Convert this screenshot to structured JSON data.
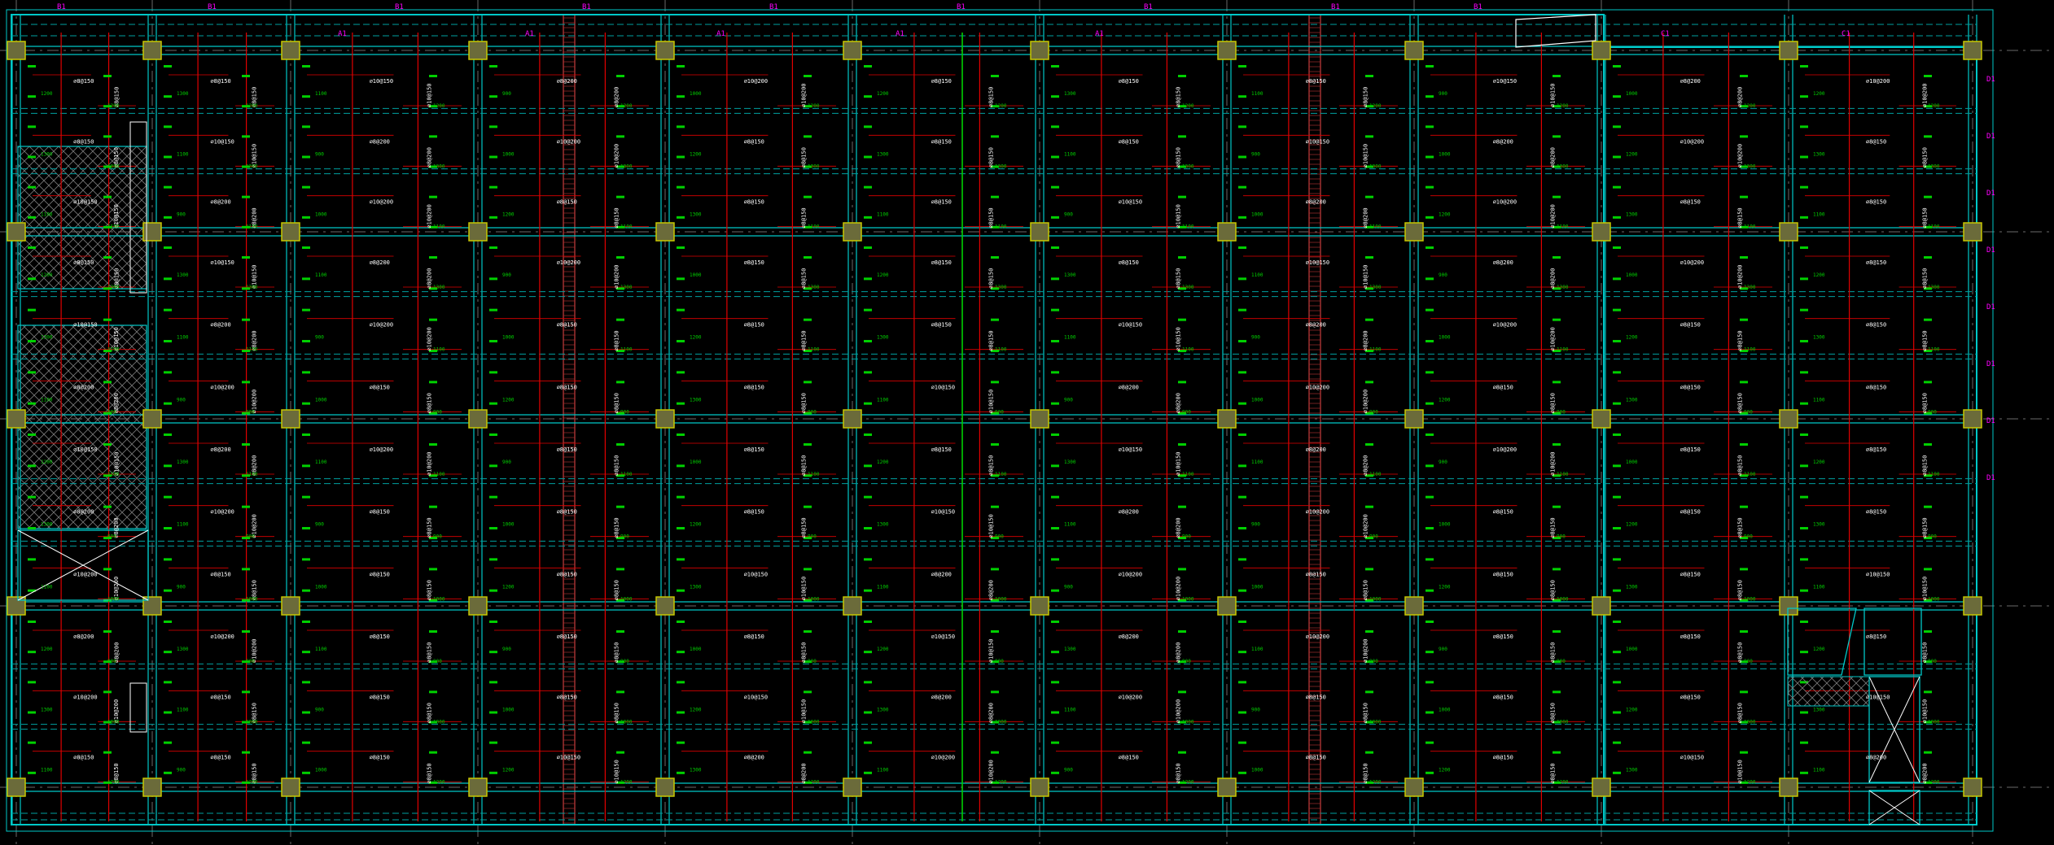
{
  "canvas": {
    "background": "#000000",
    "kind": "CAD structural floor slab reinforcement plan"
  },
  "colors": {
    "grid_axis": "#6a6a6a",
    "beam_outline": "#00c8c8",
    "beam_dashed": "#00a0a0",
    "column_fill": "#6b6b3a",
    "column_stroke": "#c8c800",
    "rebar_red": "#e00000",
    "rebar_green": "#00d000",
    "label_white": "#ffffff",
    "label_magenta": "#ff00ff",
    "hatch": "#7a7a7a",
    "wall_brick": "#a03030"
  },
  "labels": {
    "beam_top": [
      "B1",
      "B1",
      "B1",
      "B1",
      "B1",
      "B1",
      "B1",
      "B1",
      "B1"
    ],
    "beam_top_A": [
      "A1",
      "A1",
      "A1",
      "A1",
      "A1",
      "A1"
    ],
    "beam_top_C": [
      "C1",
      "C1"
    ],
    "beam_right": [
      "D1",
      "D1",
      "D1",
      "D1",
      "D1",
      "D1",
      "D1",
      "D1"
    ],
    "rebar_spec": [
      "⌀8@150",
      "⌀8@150",
      "⌀10@150",
      "⌀8@200",
      "⌀10@200",
      "⌀8@150"
    ],
    "span_values": [
      "1200",
      "1300",
      "1100",
      "900",
      "1000"
    ]
  },
  "icons": {
    "column": "column-marker",
    "shaft": "shaft-cross",
    "hatch": "hatched-slab"
  }
}
